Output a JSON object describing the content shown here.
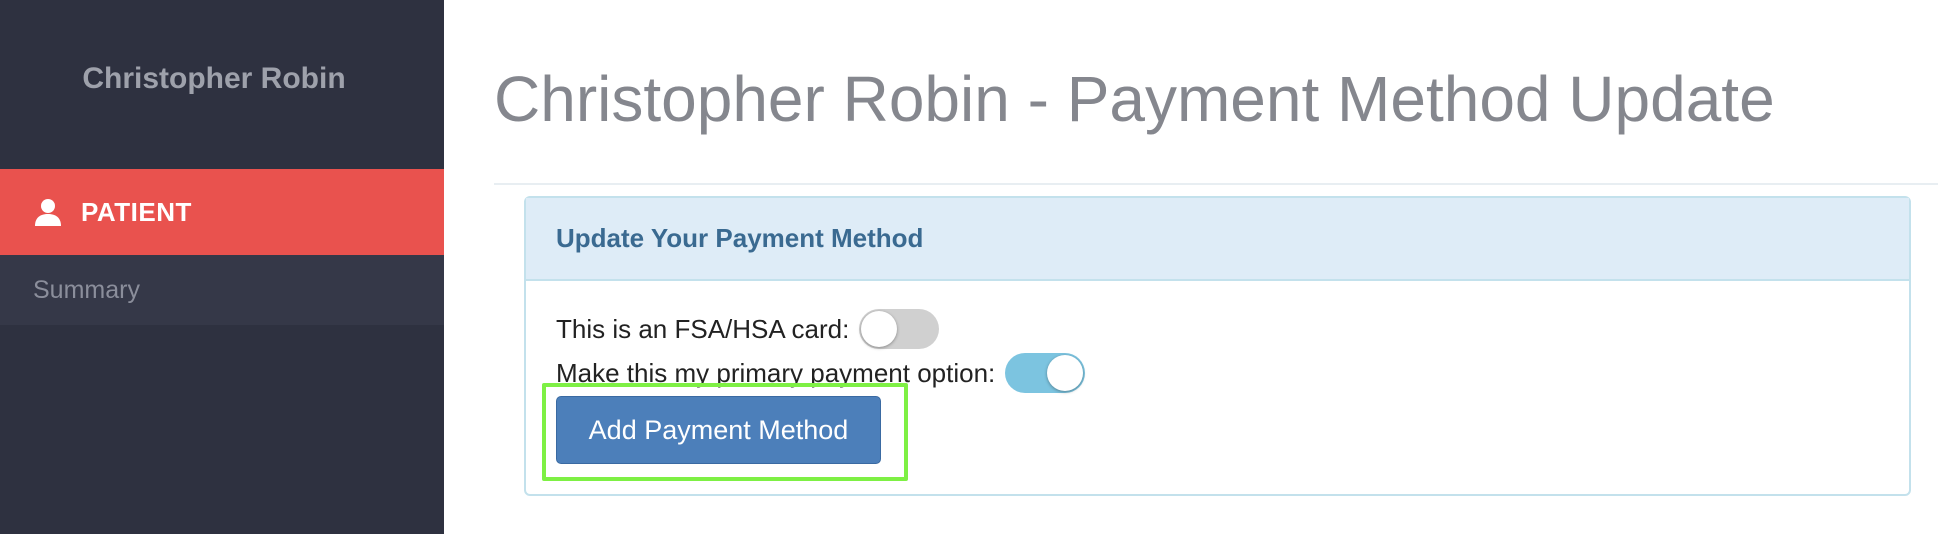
{
  "sidebar": {
    "user_name": "Christopher Robin",
    "section": {
      "label": "PATIENT",
      "icon": "user-icon"
    },
    "items": [
      {
        "label": "Summary"
      }
    ]
  },
  "main": {
    "title": "Christopher Robin - Payment Method Update",
    "panel": {
      "heading": "Update Your Payment Method",
      "fsa_toggle": {
        "label": "This is an FSA/HSA card:",
        "checked": false
      },
      "primary_toggle": {
        "label": "Make this my primary payment option:",
        "checked": true
      },
      "add_button_label": "Add Payment Method"
    }
  },
  "colors": {
    "sidebar_bg": "#2e3140",
    "accent_red": "#e9524e",
    "button_blue": "#4c7fba",
    "toggle_on": "#7cc4e0",
    "highlight_green": "#7ef044"
  }
}
